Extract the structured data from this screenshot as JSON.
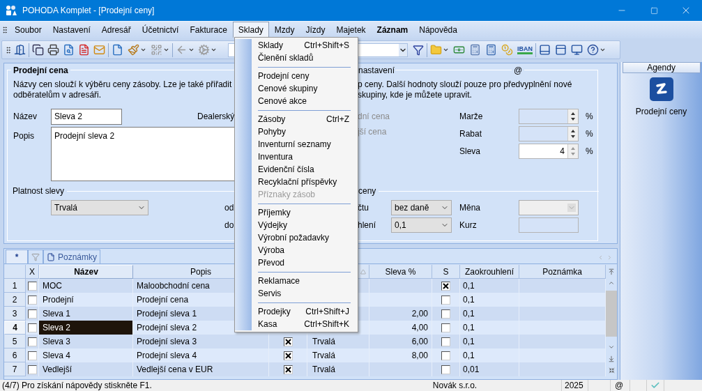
{
  "window": {
    "title": "POHODA Komplet - [Prodejní ceny]"
  },
  "menu_bar": [
    {
      "label": "Soubor",
      "selected": false,
      "bold": false
    },
    {
      "label": "Nastavení",
      "selected": false,
      "bold": false
    },
    {
      "label": "Adresář",
      "selected": false,
      "bold": false
    },
    {
      "label": "Účetnictví",
      "selected": false,
      "bold": false
    },
    {
      "label": "Fakturace",
      "selected": false,
      "bold": false
    },
    {
      "label": "Sklady",
      "selected": true,
      "bold": false
    },
    {
      "label": "Mzdy",
      "selected": false,
      "bold": false
    },
    {
      "label": "Jízdy",
      "selected": false,
      "bold": false
    },
    {
      "label": "Majetek",
      "selected": false,
      "bold": false
    },
    {
      "label": "Záznam",
      "selected": false,
      "bold": true
    },
    {
      "label": "Nápověda",
      "selected": false,
      "bold": false
    }
  ],
  "open_menu": {
    "groups": [
      [
        {
          "label": "Sklady",
          "shortcut": "Ctrl+Shift+S",
          "disabled": false
        },
        {
          "label": "Členění skladů",
          "disabled": false
        }
      ],
      [
        {
          "label": "Prodejní ceny",
          "disabled": false
        },
        {
          "label": "Cenové skupiny",
          "disabled": false
        },
        {
          "label": "Cenové akce",
          "disabled": false
        }
      ],
      [
        {
          "label": "Zásoby",
          "shortcut": "Ctrl+Z",
          "disabled": false
        },
        {
          "label": "Pohyby",
          "disabled": false
        },
        {
          "label": "Inventurní seznamy",
          "disabled": false
        },
        {
          "label": "Inventura",
          "disabled": false
        },
        {
          "label": "Evidenční čísla",
          "disabled": false
        },
        {
          "label": "Recyklační příspěvky",
          "disabled": false
        },
        {
          "label": "Příznaky zásob",
          "disabled": true
        }
      ],
      [
        {
          "label": "Příjemky",
          "disabled": false
        },
        {
          "label": "Výdejky",
          "disabled": false
        },
        {
          "label": "Výrobní požadavky",
          "disabled": false
        },
        {
          "label": "Výroba",
          "disabled": false
        },
        {
          "label": "Převod",
          "disabled": false
        }
      ],
      [
        {
          "label": "Reklamace",
          "disabled": false
        },
        {
          "label": "Servis",
          "disabled": false
        }
      ],
      [
        {
          "label": "Prodejky",
          "shortcut": "Ctrl+Shift+J",
          "disabled": false
        },
        {
          "label": "Kasa",
          "shortcut": "Ctrl+Shift+K",
          "disabled": false
        }
      ]
    ]
  },
  "toolbar": {
    "iban_label": "IBAN"
  },
  "form": {
    "title": "Prodejní cena",
    "title_right": "nastavení",
    "email_mark": "@",
    "description_left": [
      "Názvy cen slouží k výběru ceny zásoby. Lze je také přiřadit",
      "odběratelům v adresáři."
    ],
    "description_right": [
      "p ceny. Další hodnoty slouží pouze pro předvyplnění nové",
      "skupiny, kde je můžete upravit."
    ],
    "name": {
      "label": "Název",
      "value": "Sleva 2"
    },
    "dealer_label": "Dealerský",
    "description_field": {
      "label": "Popis",
      "value": "Prodejní sleva 2"
    },
    "greyed_options": [
      {
        "label": "dní cena",
        "disabled": true
      },
      {
        "label": "jší cena",
        "disabled": true
      }
    ],
    "spin_fields": [
      {
        "label": "Marže",
        "unit": "%",
        "disabled": true
      },
      {
        "label": "Rabat",
        "unit": "%",
        "disabled": true
      },
      {
        "label": "Sleva",
        "value": "4",
        "unit": "%",
        "disabled": false
      }
    ],
    "validity": {
      "title": "Platnost slevy",
      "select": "Trvalá",
      "from_label": "od",
      "to_label": "do"
    },
    "price_section": {
      "title": "ceny",
      "rows": [
        {
          "label": "čtu",
          "select": "bez daně"
        },
        {
          "label": "hlení",
          "select": "0,1"
        }
      ]
    },
    "currency": {
      "label": "Měna",
      "disabled": true
    },
    "rate": {
      "label": "Kurz"
    }
  },
  "table": {
    "tabs": [
      {
        "kind": "text",
        "label": "*"
      },
      {
        "kind": "filter"
      },
      {
        "kind": "note",
        "label": "Poznámky"
      }
    ],
    "columns": {
      "x": "X",
      "name": "Název",
      "description": "Popis",
      "discount": "Sleva %",
      "s": "S",
      "rounding": "Zaokrouhlení",
      "note": "Poznámka"
    },
    "rows": [
      {
        "number": "1",
        "x_checked": false,
        "name": "MOC",
        "description": "Maloobchodní cena",
        "s_checked": true,
        "rounding": "0,1",
        "selected": false
      },
      {
        "number": "2",
        "x_checked": false,
        "name": "Prodejní",
        "description": "Prodejní cena",
        "s_checked": false,
        "rounding": "0,1",
        "selected": false
      },
      {
        "number": "3",
        "x_checked": false,
        "name": "Sleva 1",
        "description": "Prodejní sleva 1",
        "discount": "2,00",
        "s_checked": false,
        "rounding": "0,1",
        "selected": false
      },
      {
        "number": "4",
        "x_checked": false,
        "name": "Sleva 2",
        "description": "Prodejní sleva 2",
        "discount": "4,00",
        "s_checked": false,
        "rounding": "0,1",
        "selected": true
      },
      {
        "number": "5",
        "x_checked": false,
        "name": "Sleva 3",
        "description": "Prodejní sleva 3",
        "column_5_checked": true,
        "column_6": "Trvalá",
        "discount": "6,00",
        "s_checked": false,
        "rounding": "0,1",
        "selected": false
      },
      {
        "number": "6",
        "x_checked": false,
        "name": "Sleva 4",
        "description": "Prodejní sleva 4",
        "column_5_checked": true,
        "column_6": "Trvalá",
        "discount": "8,00",
        "s_checked": false,
        "rounding": "0,1",
        "selected": false
      },
      {
        "number": "7",
        "x_checked": false,
        "name": "Vedlejší",
        "description": "Vedlejší cena v EUR",
        "column_5_checked": true,
        "column_6": "Trvalá",
        "s_checked": false,
        "rounding": "0,01",
        "selected": false
      }
    ]
  },
  "agenda_panel": {
    "title": "Agendy",
    "item": "Prodejní ceny"
  },
  "status_bar": {
    "message": "(4/7) Pro získání nápovědy stiskněte F1.",
    "company": "Novák s.r.o.",
    "year": "2025",
    "email_mark": "@"
  }
}
